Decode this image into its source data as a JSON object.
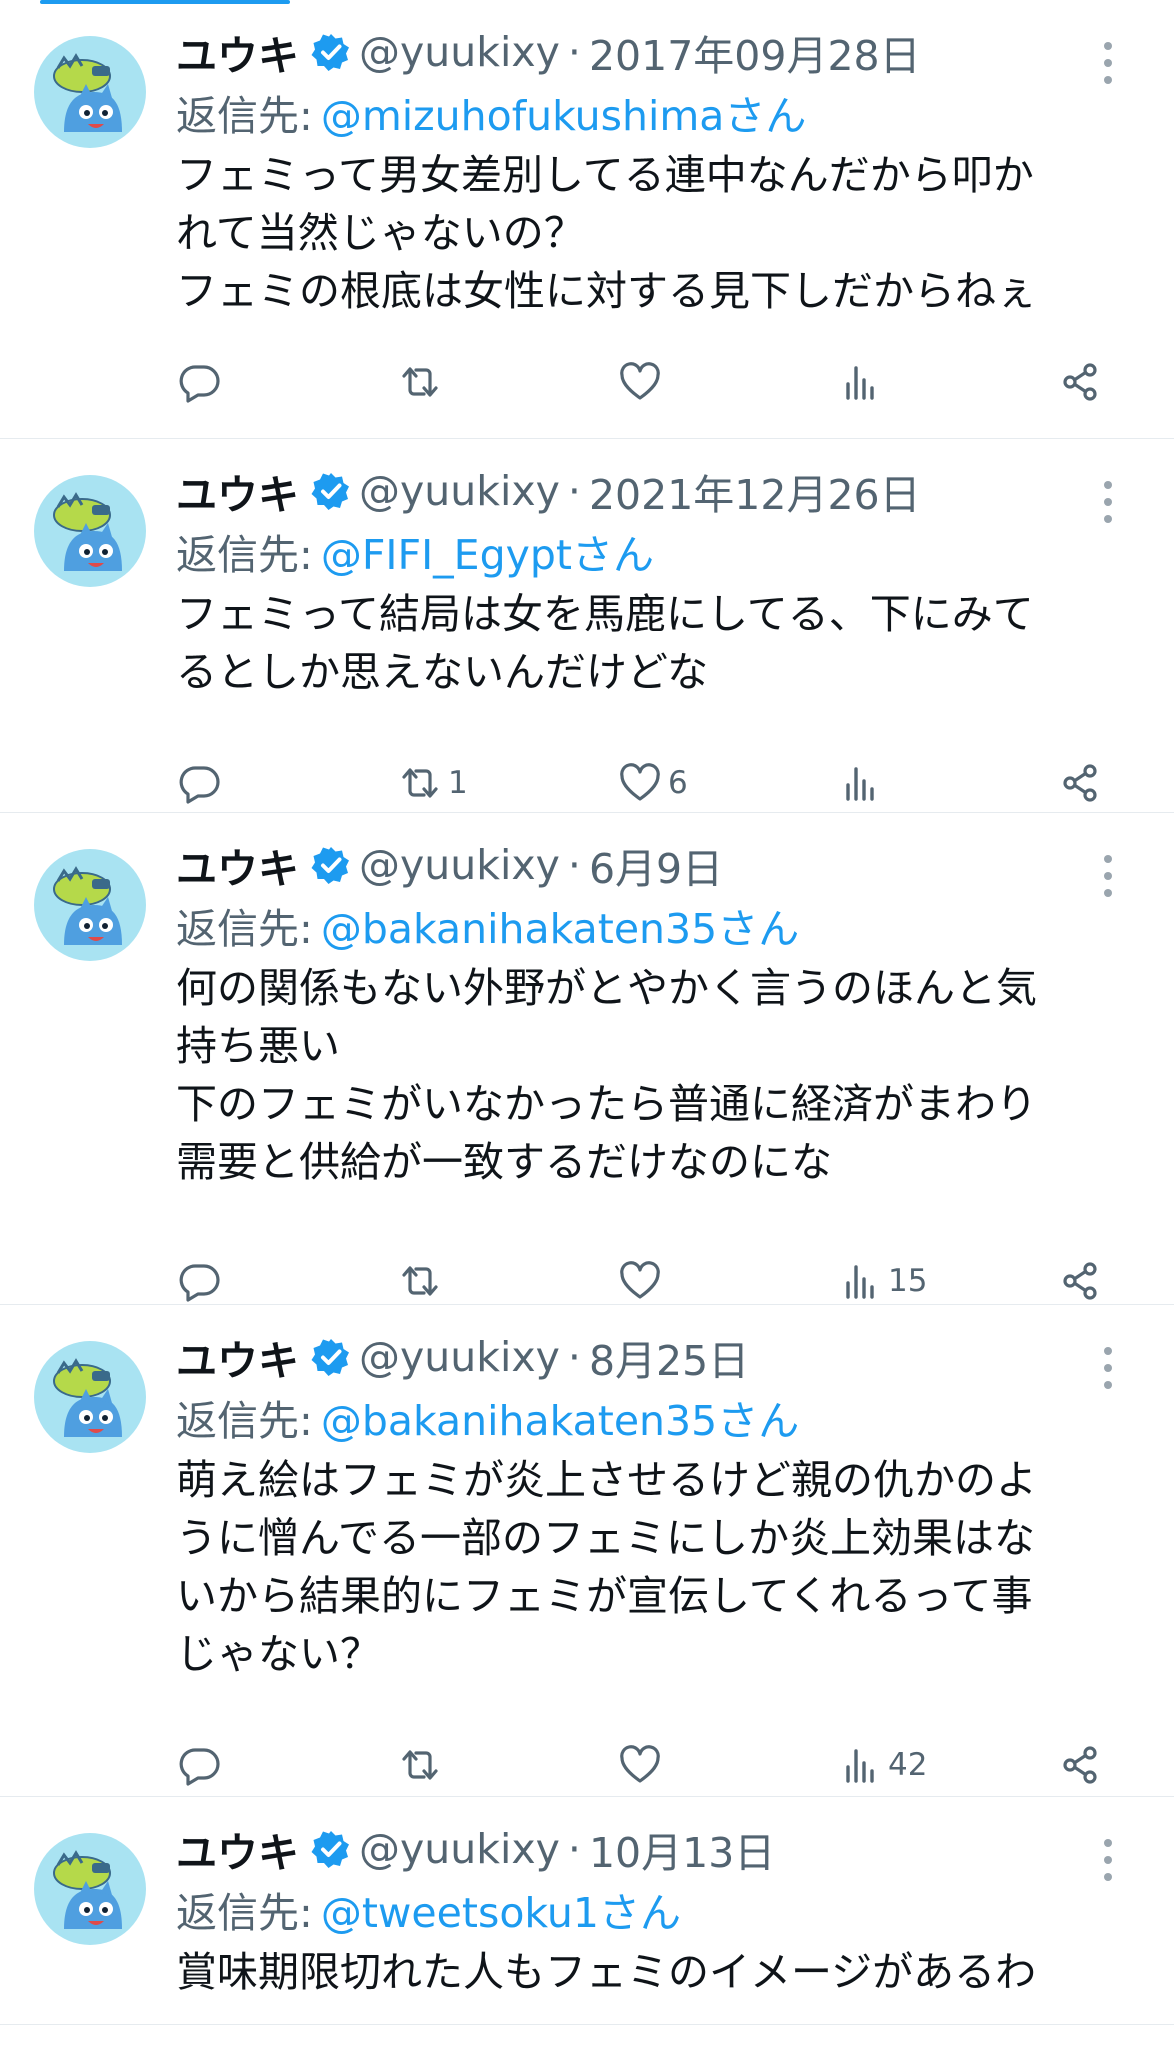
{
  "tweets": [
    {
      "name": "ユウキ",
      "handle": "@yuukixy",
      "separator": "·",
      "date": "2017年09月28日",
      "reply_label": "返信先:",
      "reply_to": "@mizuhofukushimaさん",
      "lines": [
        "フェミって男女差別してる連中なんだから叩か",
        "れて当然じゃないの？",
        "フェミの根底は女性に対する見下しだからねぇ"
      ],
      "counts": {
        "reply": "",
        "retweet": "",
        "like": "",
        "views": ""
      }
    },
    {
      "name": "ユウキ",
      "handle": "@yuukixy",
      "separator": "·",
      "date": "2021年12月26日",
      "reply_label": "返信先:",
      "reply_to": "@FIFI_Egyptさん",
      "lines": [
        "フェミって結局は女を馬鹿にしてる、下にみて",
        "るとしか思えないんだけどな"
      ],
      "counts": {
        "reply": "",
        "retweet": "1",
        "like": "6",
        "views": ""
      }
    },
    {
      "name": "ユウキ",
      "handle": "@yuukixy",
      "separator": "·",
      "date": "6月9日",
      "reply_label": "返信先:",
      "reply_to": "@bakanihakaten35さん",
      "lines": [
        "何の関係もない外野がとやかく言うのほんと気",
        "持ち悪い",
        "下のフェミがいなかったら普通に経済がまわり",
        "需要と供給が一致するだけなのにな"
      ],
      "counts": {
        "reply": "",
        "retweet": "",
        "like": "",
        "views": "15"
      }
    },
    {
      "name": "ユウキ",
      "handle": "@yuukixy",
      "separator": "·",
      "date": "8月25日",
      "reply_label": "返信先:",
      "reply_to": "@bakanihakaten35さん",
      "lines": [
        "萌え絵はフェミが炎上させるけど親の仇かのよ",
        "うに憎んでる一部のフェミにしか炎上効果はな",
        "いから結果的にフェミが宣伝してくれるって事",
        "じゃない？"
      ],
      "counts": {
        "reply": "",
        "retweet": "",
        "like": "",
        "views": "42"
      }
    },
    {
      "name": "ユウキ",
      "handle": "@yuukixy",
      "separator": "·",
      "date": "10月13日",
      "reply_label": "返信先:",
      "reply_to": "@tweetsoku1さん",
      "lines": [
        "賞味期限切れた人もフェミのイメージがあるわ"
      ],
      "counts": {
        "reply": "",
        "retweet": "",
        "like": "",
        "views": ""
      }
    }
  ],
  "icons": {
    "verified": "verified-badge-icon",
    "more": "more-vertical-icon",
    "reply": "reply-icon",
    "retweet": "retweet-icon",
    "like": "heart-icon",
    "views": "views-icon",
    "share": "share-icon"
  },
  "colors": {
    "accent": "#1d9bf0",
    "muted": "#536471",
    "text": "#0f1419",
    "divider": "#e6ebef",
    "avatar_bg": "#a9e3f2"
  }
}
